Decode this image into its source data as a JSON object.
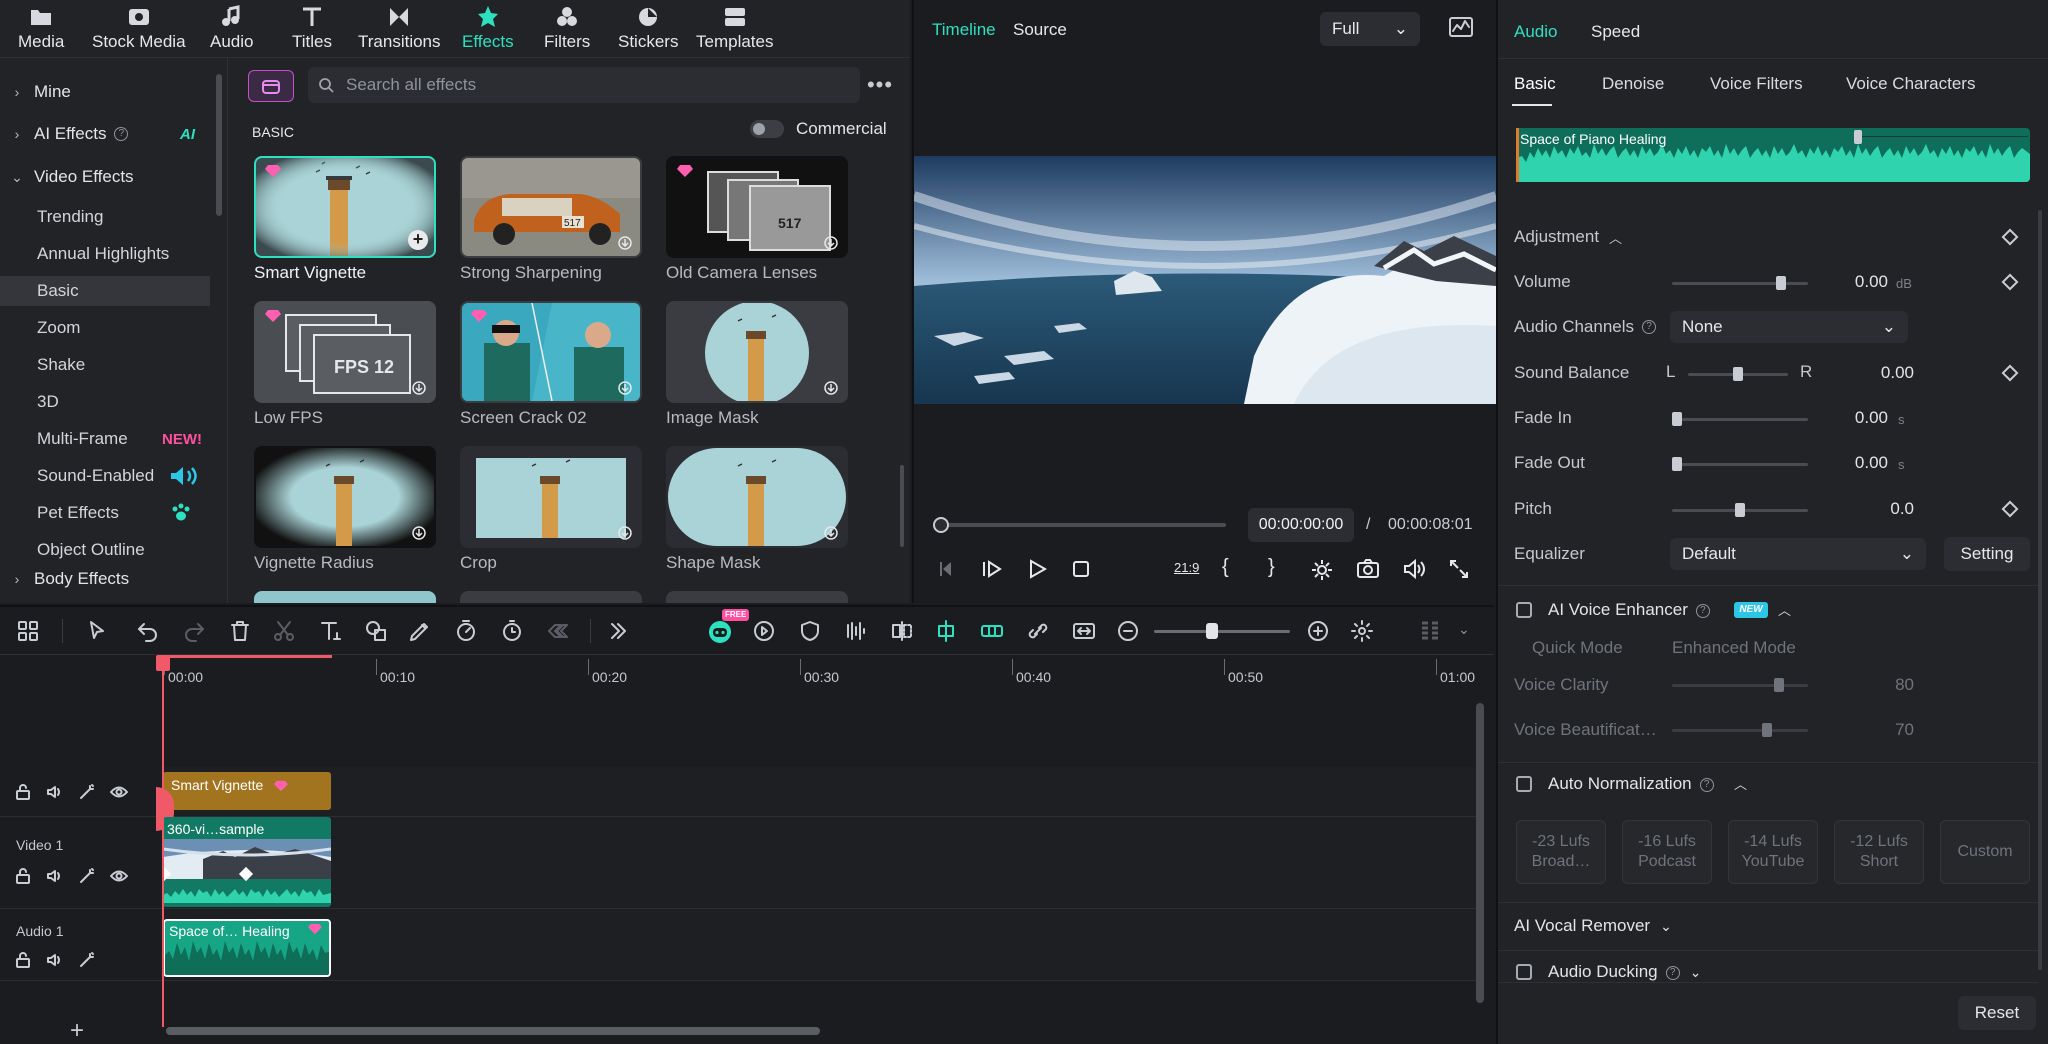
{
  "library": {
    "tabs": [
      {
        "label": "Media",
        "icon": "media-folder-icon"
      },
      {
        "label": "Stock Media",
        "icon": "stock-media-icon"
      },
      {
        "label": "Audio",
        "icon": "music-note-icon"
      },
      {
        "label": "Titles",
        "icon": "titles-T-icon"
      },
      {
        "label": "Transitions",
        "icon": "transitions-bowtie-icon"
      },
      {
        "label": "Effects",
        "icon": "effects-star-icon",
        "active": true
      },
      {
        "label": "Filters",
        "icon": "filters-circles-icon"
      },
      {
        "label": "Stickers",
        "icon": "stickers-icon"
      },
      {
        "label": "Templates",
        "icon": "templates-grid-icon"
      }
    ],
    "categories": [
      {
        "label": "Mine",
        "type": "group",
        "expanded": false
      },
      {
        "label": "AI Effects",
        "type": "group",
        "expanded": false,
        "badge": "AI"
      },
      {
        "label": "Video Effects",
        "type": "group",
        "expanded": true
      },
      {
        "label": "Trending",
        "type": "sub"
      },
      {
        "label": "Annual Highlights",
        "type": "sub"
      },
      {
        "label": "Basic",
        "type": "sub",
        "selected": true
      },
      {
        "label": "Zoom",
        "type": "sub"
      },
      {
        "label": "Shake",
        "type": "sub"
      },
      {
        "label": "3D",
        "type": "sub"
      },
      {
        "label": "Multi-Frame",
        "type": "sub",
        "badge": "NEW!"
      },
      {
        "label": "Sound-Enabled",
        "type": "sub"
      },
      {
        "label": "Pet Effects",
        "type": "sub"
      },
      {
        "label": "Object Outline",
        "type": "sub"
      },
      {
        "label": "Body Effects",
        "type": "group",
        "expanded": false
      }
    ],
    "search_placeholder": "Search all effects",
    "section_label": "BASIC",
    "commercial_label": "Commercial",
    "effects": [
      {
        "label": "Smart Vignette",
        "premium": true,
        "selected": true
      },
      {
        "label": "Strong Sharpening",
        "premium": false
      },
      {
        "label": "Old Camera Lenses",
        "premium": true
      },
      {
        "label": "Low FPS",
        "premium": true,
        "thumb_text": "FPS 12"
      },
      {
        "label": "Screen Crack 02",
        "premium": true
      },
      {
        "label": "Image Mask",
        "premium": false
      },
      {
        "label": "Vignette Radius",
        "premium": false
      },
      {
        "label": "Crop",
        "premium": false
      },
      {
        "label": "Shape Mask",
        "premium": false
      }
    ]
  },
  "player": {
    "tab_timeline": "Timeline",
    "tab_source": "Source",
    "quality": "Full",
    "current_time": "00:00:00:00",
    "separator": "/",
    "total_time": "00:00:08:01",
    "ratio_label": "21:9"
  },
  "props": {
    "tab_audio": "Audio",
    "tab_speed": "Speed",
    "subtabs": [
      "Basic",
      "Denoise",
      "Voice Filters",
      "Voice Characters"
    ],
    "clip_name": "Space of Piano Healing",
    "adjustment_label": "Adjustment",
    "volume": {
      "label": "Volume",
      "value": "0.00",
      "unit": "dB",
      "level": 0.8
    },
    "audio_channels": {
      "label": "Audio Channels",
      "value": "None"
    },
    "sound_balance": {
      "label": "Sound Balance",
      "left": "L",
      "right": "R",
      "value": "0.00",
      "level": 0.5
    },
    "fade_in": {
      "label": "Fade In",
      "value": "0.00",
      "unit": "s"
    },
    "fade_out": {
      "label": "Fade Out",
      "value": "0.00",
      "unit": "s"
    },
    "pitch": {
      "label": "Pitch",
      "value": "0.0",
      "level": 0.5
    },
    "equalizer": {
      "label": "Equalizer",
      "value": "Default",
      "button": "Setting"
    },
    "ai_voice_enhancer": {
      "label": "AI Voice Enhancer",
      "badge": "NEW",
      "mode1": "Quick Mode",
      "mode2": "Enhanced Mode",
      "clarity_label": "Voice Clarity",
      "clarity_value": "80",
      "beautification_label": "Voice Beautificat…",
      "beautification_value": "70"
    },
    "auto_normalization": {
      "label": "Auto Normalization",
      "presets": [
        {
          "l1": "-23 Lufs",
          "l2": "Broad…"
        },
        {
          "l1": "-16 Lufs",
          "l2": "Podcast"
        },
        {
          "l1": "-14 Lufs",
          "l2": "YouTube"
        },
        {
          "l1": "-12 Lufs",
          "l2": "Short"
        },
        {
          "l1": "Custom",
          "l2": ""
        }
      ]
    },
    "ai_vocal_remover": "AI Vocal Remover",
    "audio_ducking": "Audio Ducking",
    "reset": "Reset"
  },
  "timeline": {
    "ruler": [
      "00:00",
      "00:10",
      "00:20",
      "00:30",
      "00:40",
      "00:50",
      "01:00"
    ],
    "tracks": {
      "video": "Video 1",
      "audio": "Audio 1"
    },
    "clips": {
      "effect": "Smart Vignette",
      "video": "360-vi…sample",
      "audio": "Space of… Healing"
    },
    "free_badge": "FREE",
    "add_track": "+"
  }
}
